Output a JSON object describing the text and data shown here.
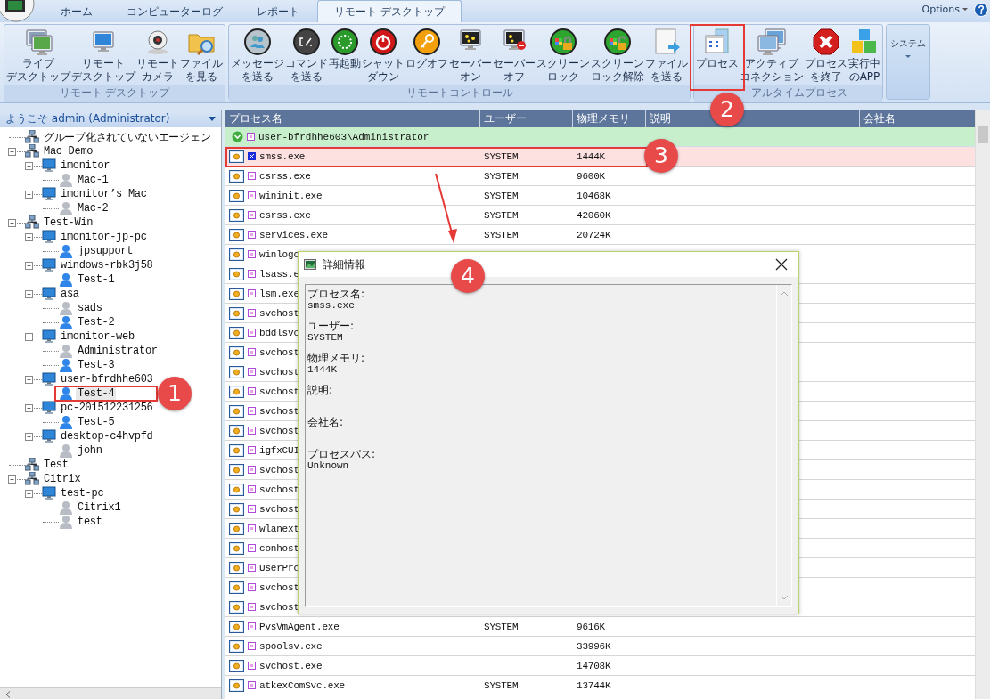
{
  "tabs": [
    {
      "label": "ホーム",
      "selected": false
    },
    {
      "label": "コンピューターログ",
      "selected": false
    },
    {
      "label": "レポート",
      "selected": false
    },
    {
      "label": "リモート デスクトップ",
      "selected": true
    }
  ],
  "options": "Options",
  "ribbon": {
    "groups": [
      {
        "label": "リモート デスクトップ",
        "buttons": [
          {
            "lines": [
              "ライブ",
              "デスクトップ"
            ]
          },
          {
            "lines": [
              "リモート",
              "デスクトップ"
            ]
          },
          {
            "lines": [
              "リモート",
              "カメラ"
            ]
          },
          {
            "lines": [
              "ファイル",
              "を見る"
            ]
          }
        ]
      },
      {
        "label": "リモートコントロール",
        "buttons": [
          {
            "lines": [
              "メッセージ",
              "を送る"
            ]
          },
          {
            "lines": [
              "コマンド",
              "を送る"
            ]
          },
          {
            "lines": [
              "再起動"
            ]
          },
          {
            "lines": [
              "シャット",
              "ダウン"
            ]
          },
          {
            "lines": [
              "ログオフ"
            ]
          },
          {
            "lines": [
              "セーバー",
              "オン"
            ]
          },
          {
            "lines": [
              "セーバー",
              "オフ"
            ]
          },
          {
            "lines": [
              "スクリーン",
              "ロック"
            ]
          },
          {
            "lines": [
              "スクリーン",
              "ロック解除"
            ]
          },
          {
            "lines": [
              "ファイル",
              "を送る"
            ]
          }
        ]
      },
      {
        "label": "アルタイムプロセス",
        "buttons": [
          {
            "lines": [
              "プロセス"
            ]
          },
          {
            "lines": [
              "アクティブ",
              "コネクション"
            ]
          },
          {
            "lines": [
              "プロセス",
              "を終了"
            ]
          },
          {
            "lines": [
              "実行中",
              "のAPP"
            ]
          }
        ]
      }
    ],
    "menu": {
      "label": "システム"
    }
  },
  "panel": {
    "header": "ようこそ admin (Administrator)",
    "tree": [
      {
        "label": "グループ化されていないエージェン",
        "kind": "group",
        "selected": false
      },
      {
        "label": "Mac Demo",
        "kind": "group",
        "selected": false,
        "expanded": true,
        "children": [
          {
            "label": "imonitor",
            "kind": "computer",
            "selected": false,
            "expanded": true,
            "children": [
              {
                "label": "Mac-1",
                "kind": "user",
                "online": false,
                "selected": false
              }
            ]
          },
          {
            "label": "imonitor’s Mac",
            "kind": "computer",
            "selected": false,
            "expanded": true,
            "children": [
              {
                "label": "Mac-2",
                "kind": "user",
                "online": false,
                "selected": false
              }
            ]
          }
        ]
      },
      {
        "label": "Test-Win",
        "kind": "group",
        "selected": false,
        "expanded": true,
        "children": [
          {
            "label": "imonitor-jp-pc",
            "kind": "computer",
            "selected": false,
            "expanded": true,
            "children": [
              {
                "label": "jpsupport",
                "kind": "user",
                "online": true,
                "selected": false
              }
            ]
          },
          {
            "label": "windows-rbk3j58",
            "kind": "computer",
            "selected": false,
            "expanded": true,
            "children": [
              {
                "label": "Test-1",
                "kind": "user",
                "online": true,
                "selected": false
              }
            ]
          },
          {
            "label": "asa",
            "kind": "computer",
            "selected": false,
            "expanded": true,
            "children": [
              {
                "label": "sads",
                "kind": "user",
                "online": false,
                "selected": false
              },
              {
                "label": "Test-2",
                "kind": "user",
                "online": true,
                "selected": false
              }
            ]
          },
          {
            "label": "imonitor-web",
            "kind": "computer",
            "selected": false,
            "expanded": true,
            "children": [
              {
                "label": "Administrator",
                "kind": "user",
                "online": false,
                "selected": false
              },
              {
                "label": "Test-3",
                "kind": "user",
                "online": true,
                "selected": false
              }
            ]
          },
          {
            "label": "user-bfrdhhe603",
            "kind": "computer",
            "selected": false,
            "expanded": true,
            "children": [
              {
                "label": "Test-4",
                "kind": "user",
                "online": true,
                "selected": true
              }
            ]
          },
          {
            "label": "pc-201512231256",
            "kind": "computer",
            "selected": false,
            "expanded": true,
            "children": [
              {
                "label": "Test-5",
                "kind": "user",
                "online": true,
                "selected": false
              }
            ]
          },
          {
            "label": "desktop-c4hvpfd",
            "kind": "computer",
            "selected": false,
            "expanded": true,
            "children": [
              {
                "label": "john",
                "kind": "user",
                "online": false,
                "selected": false
              }
            ]
          }
        ]
      },
      {
        "label": "Test",
        "kind": "group",
        "selected": false
      },
      {
        "label": "Citrix",
        "kind": "group",
        "selected": false,
        "expanded": true,
        "children": [
          {
            "label": "test-pc",
            "kind": "computer",
            "selected": false,
            "expanded": true,
            "children": [
              {
                "label": "Citrix1",
                "kind": "user",
                "online": false,
                "selected": false
              },
              {
                "label": "test",
                "kind": "user",
                "online": false,
                "selected": false
              }
            ]
          }
        ]
      }
    ]
  },
  "table": {
    "columns": [
      "プロセス名",
      "ユーザー",
      "物理メモリ",
      "説明",
      "会社名"
    ],
    "rows": [
      {
        "kind": "group",
        "name": "user-bfrdhhe603\\Administrator",
        "expanded": true
      },
      {
        "kind": "process",
        "name": "smss.exe",
        "user": "SYSTEM",
        "memory": "1444K",
        "selected": true
      },
      {
        "kind": "process",
        "name": "csrss.exe",
        "user": "SYSTEM",
        "memory": "9600K",
        "selected": false
      },
      {
        "kind": "process",
        "name": "wininit.exe",
        "user": "SYSTEM",
        "memory": "10468K",
        "selected": false
      },
      {
        "kind": "process",
        "name": "csrss.exe",
        "user": "SYSTEM",
        "memory": "42060K",
        "selected": false
      },
      {
        "kind": "process",
        "name": "services.exe",
        "user": "SYSTEM",
        "memory": "20724K",
        "selected": false
      },
      {
        "kind": "process",
        "name": "winlogo",
        "selected": false
      },
      {
        "kind": "process",
        "name": "lsass.e",
        "selected": false
      },
      {
        "kind": "process",
        "name": "lsm.exe",
        "selected": false
      },
      {
        "kind": "process",
        "name": "svchost",
        "selected": false
      },
      {
        "kind": "process",
        "name": "bddlsvc",
        "selected": false
      },
      {
        "kind": "process",
        "name": "svchost",
        "selected": false
      },
      {
        "kind": "process",
        "name": "svchost",
        "selected": false
      },
      {
        "kind": "process",
        "name": "svchost",
        "selected": false
      },
      {
        "kind": "process",
        "name": "svchost",
        "selected": false
      },
      {
        "kind": "process",
        "name": "svchost",
        "selected": false
      },
      {
        "kind": "process",
        "name": "igfxCUI",
        "selected": false
      },
      {
        "kind": "process",
        "name": "svchost",
        "selected": false
      },
      {
        "kind": "process",
        "name": "svchost",
        "selected": false
      },
      {
        "kind": "process",
        "name": "svchost",
        "selected": false
      },
      {
        "kind": "process",
        "name": "wlanext",
        "selected": false
      },
      {
        "kind": "process",
        "name": "conhost",
        "selected": false
      },
      {
        "kind": "process",
        "name": "UserPro",
        "selected": false
      },
      {
        "kind": "process",
        "name": "svchost",
        "selected": false
      },
      {
        "kind": "process",
        "name": "svchost",
        "selected": false
      },
      {
        "kind": "process",
        "name": "PvsVmAgent.exe",
        "user": "SYSTEM",
        "memory": "9616K",
        "selected": false
      },
      {
        "kind": "process",
        "name": "spoolsv.exe",
        "memory": "33996K",
        "selected": false
      },
      {
        "kind": "process",
        "name": "svchost.exe",
        "memory": "14708K",
        "selected": false
      },
      {
        "kind": "process",
        "name": "atkexComSvc.exe",
        "user": "SYSTEM",
        "memory": "13744K",
        "selected": false
      }
    ]
  },
  "dialog": {
    "title": "詳細情報",
    "fields": [
      {
        "label": "プロセス名:",
        "value": "smss.exe"
      },
      {
        "label": "ユーザー:",
        "value": "SYSTEM"
      },
      {
        "label": "物理メモリ:",
        "value": "1444K"
      },
      {
        "label": "説明:"
      },
      {
        "label": "会社名:"
      },
      {
        "label": "プロセスパス:",
        "value": "Unknown"
      }
    ]
  },
  "annotations": [
    {
      "number": "1"
    },
    {
      "number": "2"
    },
    {
      "number": "3"
    },
    {
      "number": "4"
    }
  ]
}
